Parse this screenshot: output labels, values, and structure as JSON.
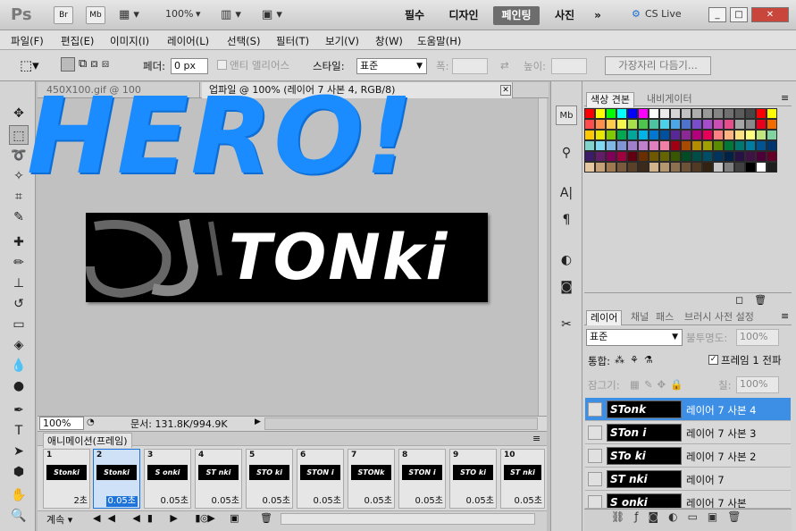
{
  "app": {
    "logo": "Ps",
    "bridge": "Br",
    "minibridge": "Mb",
    "zoom": "100%",
    "workspaces": [
      "필수",
      "디자인",
      "페인팅",
      "사진"
    ],
    "active_workspace": "페인팅",
    "more": "»",
    "cslive": "CS Live",
    "winbtns": [
      "_",
      "□",
      "✕"
    ]
  },
  "menu": [
    "파일(F)",
    "편집(E)",
    "이미지(I)",
    "레이어(L)",
    "선택(S)",
    "필터(T)",
    "보기(V)",
    "창(W)",
    "도움말(H)"
  ],
  "options": {
    "feather_label": "페더:",
    "feather_value": "0 px",
    "antialias": "앤티 앨리어스",
    "style_label": "스타일:",
    "style_value": "표준",
    "width_label": "폭:",
    "height_label": "높이:",
    "refine_button": "가장자리 다듬기..."
  },
  "doc": {
    "tab1": "450X100.gif @ 100",
    "tab2": "업파일 @ 100% (레이어 7 사본 4, RGB/8)",
    "overlay": "HERO!",
    "banner_text": "TONki",
    "status_zoom": "100%",
    "status_doc": "문서: 131.8K/994.9K"
  },
  "animation": {
    "title": "애니메이션(프레임)",
    "loop": "계속",
    "frames": [
      {
        "n": "1",
        "thumb": "Stonki",
        "delay": "2초"
      },
      {
        "n": "2",
        "thumb": "Stonki",
        "delay": "0.05초"
      },
      {
        "n": "3",
        "thumb": "S onki",
        "delay": "0.05초"
      },
      {
        "n": "4",
        "thumb": "ST nki",
        "delay": "0.05초"
      },
      {
        "n": "5",
        "thumb": "STO ki",
        "delay": "0.05초"
      },
      {
        "n": "6",
        "thumb": "STON i",
        "delay": "0.05초"
      },
      {
        "n": "7",
        "thumb": "STONk",
        "delay": "0.05초"
      },
      {
        "n": "8",
        "thumb": "STON i",
        "delay": "0.05초"
      },
      {
        "n": "9",
        "thumb": "STO ki",
        "delay": "0.05초"
      },
      {
        "n": "10",
        "thumb": "ST nki",
        "delay": "0.05초"
      }
    ]
  },
  "swatch_panel": {
    "tab_active": "색상 견본",
    "tab_other": "내비게이터"
  },
  "swatches": [
    "#ff0000",
    "#ffff00",
    "#00ff00",
    "#00ffff",
    "#0000ff",
    "#ff00ff",
    "#ffffff",
    "#ebebeb",
    "#d6d6d6",
    "#c2c2c2",
    "#adadad",
    "#999999",
    "#858585",
    "#707070",
    "#5c5c5c",
    "#474747",
    "#ff0000",
    "#ffff00",
    "#ff4d4d",
    "#ff8f4d",
    "#ffcc4d",
    "#f5f54d",
    "#a8e04d",
    "#4dc44d",
    "#4dc4a0",
    "#4dd1e6",
    "#4da6e6",
    "#4d73cc",
    "#7a4dcc",
    "#a64dcc",
    "#cc4db3",
    "#e64d8a",
    "#a6a6a6",
    "#8a8a8a",
    "#e8001c",
    "#f26b00",
    "#ffc800",
    "#e6e600",
    "#80c800",
    "#00a850",
    "#00a89c",
    "#00b4e6",
    "#0078d2",
    "#0050a0",
    "#5a2896",
    "#8c2896",
    "#b4007d",
    "#e6005a",
    "#ff8080",
    "#ffb380",
    "#ffe080",
    "#ffff80",
    "#c0e680",
    "#80d4a0",
    "#80d4cc",
    "#80d8f2",
    "#80b8e6",
    "#8096d4",
    "#a080cc",
    "#c080cc",
    "#e080c0",
    "#f280a6",
    "#a00014",
    "#a84a00",
    "#b48c00",
    "#a0a000",
    "#5a8c00",
    "#007838",
    "#00786e",
    "#007ca0",
    "#005494",
    "#003670",
    "#3c1c68",
    "#621c68",
    "#7e0058",
    "#a0003e",
    "#600010",
    "#6a2e00",
    "#705800",
    "#646400",
    "#385800",
    "#004c24",
    "#004c46",
    "#004e66",
    "#00345c",
    "#002246",
    "#261244",
    "#3e1244",
    "#4e0038",
    "#640028",
    "#e6c8a0",
    "#c8a078",
    "#a07850",
    "#7a5a3c",
    "#5a4028",
    "#3c2a1a",
    "#d2b48c",
    "#b49670",
    "#8c7050",
    "#6e5238",
    "#503a24",
    "#322212",
    "#c8c8c8",
    "#808080",
    "#404040",
    "#000000",
    "#ffffff",
    "#1e1e1e"
  ],
  "layers_panel": {
    "tabs": [
      "레이어",
      "채널",
      "패스",
      "브러시 사전 설정"
    ],
    "blend": "표준",
    "opacity_label": "불투명도:",
    "opacity": "100%",
    "unify_label": "통합:",
    "frame_label": "프레임 1 전파",
    "lock_label": "잠그기:",
    "fill_label": "칠:",
    "fill": "100%",
    "layers": [
      {
        "thumb": "STonk",
        "name": "레이어 7 사본 4",
        "selected": true
      },
      {
        "thumb": "STon i",
        "name": "레이어 7 사본 3",
        "selected": false
      },
      {
        "thumb": "STo ki",
        "name": "레이어 7 사본 2",
        "selected": false
      },
      {
        "thumb": "ST nki",
        "name": "레이어 7",
        "selected": false
      },
      {
        "thumb": "S onki",
        "name": "레이어 7 사본",
        "selected": false
      }
    ]
  }
}
